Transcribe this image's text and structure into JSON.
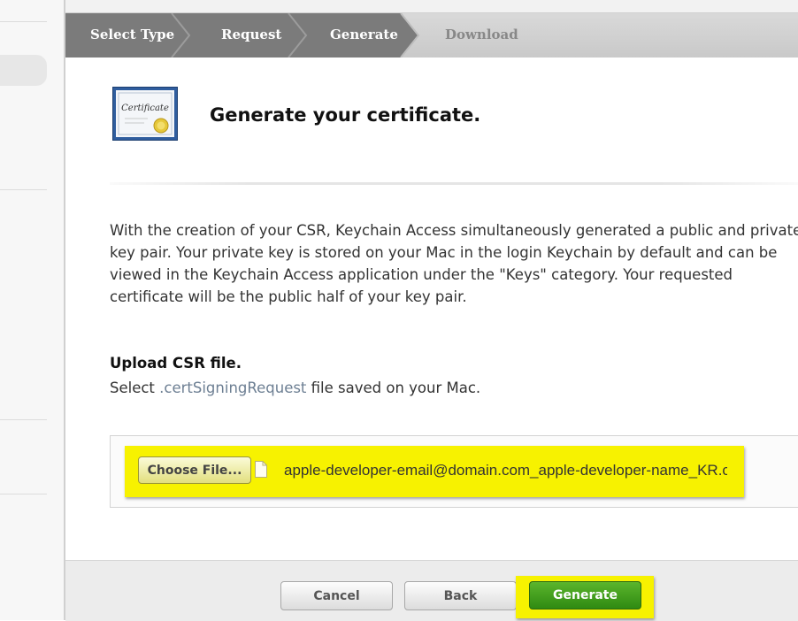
{
  "steps": [
    {
      "label": "Select Type",
      "state": "done"
    },
    {
      "label": "Request",
      "state": "done"
    },
    {
      "label": "Generate",
      "state": "current"
    },
    {
      "label": "Download",
      "state": "upcoming"
    }
  ],
  "certificate_icon": {
    "text": "Certificate"
  },
  "page_title": "Generate your certificate.",
  "description": "With the creation of your CSR, Keychain Access simultaneously generated a public and private key pair. Your private key is stored on your Mac in the login Keychain by default and can be viewed in the Keychain Access application under the \"Keys\" category. Your requested certificate will be the public half of your key pair.",
  "upload": {
    "title": "Upload CSR file.",
    "desc_before": "Select ",
    "desc_ext": ".certSigningRequest",
    "desc_after": " file saved on your Mac.",
    "choose_label": "Choose File...",
    "file_name": "apple-developer-email@domain.com_apple-developer-name_KR.certSigningRequest"
  },
  "buttons": {
    "cancel": "Cancel",
    "back": "Back",
    "generate": "Generate"
  },
  "colors": {
    "highlight": "#f7f200",
    "generate_green": "#3f9a1c",
    "step_active": "#7b7b7b",
    "step_inactive": "#cfcfcf"
  }
}
